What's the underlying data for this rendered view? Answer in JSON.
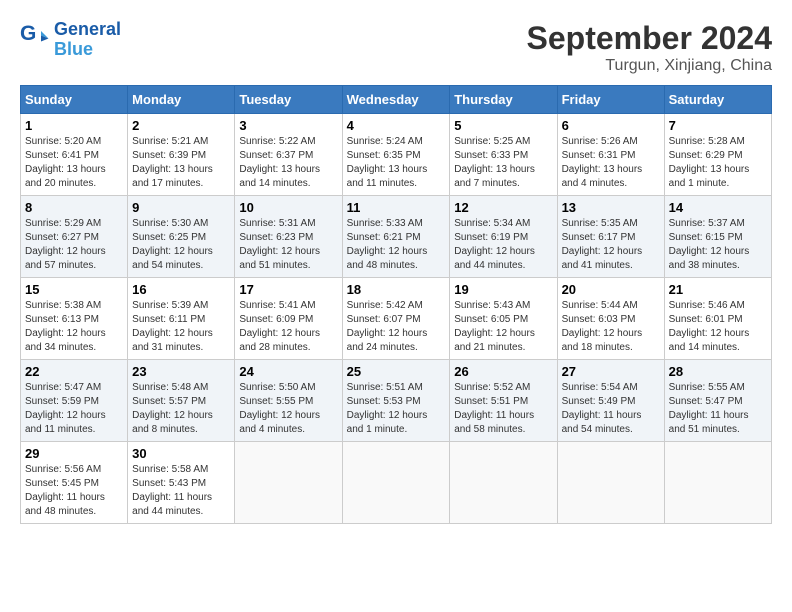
{
  "header": {
    "logo_text_line1": "General",
    "logo_text_line2": "Blue",
    "month_title": "September 2024",
    "location": "Turgun, Xinjiang, China"
  },
  "weekdays": [
    "Sunday",
    "Monday",
    "Tuesday",
    "Wednesday",
    "Thursday",
    "Friday",
    "Saturday"
  ],
  "weeks": [
    [
      {
        "day": "1",
        "info": "Sunrise: 5:20 AM\nSunset: 6:41 PM\nDaylight: 13 hours\nand 20 minutes."
      },
      {
        "day": "2",
        "info": "Sunrise: 5:21 AM\nSunset: 6:39 PM\nDaylight: 13 hours\nand 17 minutes."
      },
      {
        "day": "3",
        "info": "Sunrise: 5:22 AM\nSunset: 6:37 PM\nDaylight: 13 hours\nand 14 minutes."
      },
      {
        "day": "4",
        "info": "Sunrise: 5:24 AM\nSunset: 6:35 PM\nDaylight: 13 hours\nand 11 minutes."
      },
      {
        "day": "5",
        "info": "Sunrise: 5:25 AM\nSunset: 6:33 PM\nDaylight: 13 hours\nand 7 minutes."
      },
      {
        "day": "6",
        "info": "Sunrise: 5:26 AM\nSunset: 6:31 PM\nDaylight: 13 hours\nand 4 minutes."
      },
      {
        "day": "7",
        "info": "Sunrise: 5:28 AM\nSunset: 6:29 PM\nDaylight: 13 hours\nand 1 minute."
      }
    ],
    [
      {
        "day": "8",
        "info": "Sunrise: 5:29 AM\nSunset: 6:27 PM\nDaylight: 12 hours\nand 57 minutes."
      },
      {
        "day": "9",
        "info": "Sunrise: 5:30 AM\nSunset: 6:25 PM\nDaylight: 12 hours\nand 54 minutes."
      },
      {
        "day": "10",
        "info": "Sunrise: 5:31 AM\nSunset: 6:23 PM\nDaylight: 12 hours\nand 51 minutes."
      },
      {
        "day": "11",
        "info": "Sunrise: 5:33 AM\nSunset: 6:21 PM\nDaylight: 12 hours\nand 48 minutes."
      },
      {
        "day": "12",
        "info": "Sunrise: 5:34 AM\nSunset: 6:19 PM\nDaylight: 12 hours\nand 44 minutes."
      },
      {
        "day": "13",
        "info": "Sunrise: 5:35 AM\nSunset: 6:17 PM\nDaylight: 12 hours\nand 41 minutes."
      },
      {
        "day": "14",
        "info": "Sunrise: 5:37 AM\nSunset: 6:15 PM\nDaylight: 12 hours\nand 38 minutes."
      }
    ],
    [
      {
        "day": "15",
        "info": "Sunrise: 5:38 AM\nSunset: 6:13 PM\nDaylight: 12 hours\nand 34 minutes."
      },
      {
        "day": "16",
        "info": "Sunrise: 5:39 AM\nSunset: 6:11 PM\nDaylight: 12 hours\nand 31 minutes."
      },
      {
        "day": "17",
        "info": "Sunrise: 5:41 AM\nSunset: 6:09 PM\nDaylight: 12 hours\nand 28 minutes."
      },
      {
        "day": "18",
        "info": "Sunrise: 5:42 AM\nSunset: 6:07 PM\nDaylight: 12 hours\nand 24 minutes."
      },
      {
        "day": "19",
        "info": "Sunrise: 5:43 AM\nSunset: 6:05 PM\nDaylight: 12 hours\nand 21 minutes."
      },
      {
        "day": "20",
        "info": "Sunrise: 5:44 AM\nSunset: 6:03 PM\nDaylight: 12 hours\nand 18 minutes."
      },
      {
        "day": "21",
        "info": "Sunrise: 5:46 AM\nSunset: 6:01 PM\nDaylight: 12 hours\nand 14 minutes."
      }
    ],
    [
      {
        "day": "22",
        "info": "Sunrise: 5:47 AM\nSunset: 5:59 PM\nDaylight: 12 hours\nand 11 minutes."
      },
      {
        "day": "23",
        "info": "Sunrise: 5:48 AM\nSunset: 5:57 PM\nDaylight: 12 hours\nand 8 minutes."
      },
      {
        "day": "24",
        "info": "Sunrise: 5:50 AM\nSunset: 5:55 PM\nDaylight: 12 hours\nand 4 minutes."
      },
      {
        "day": "25",
        "info": "Sunrise: 5:51 AM\nSunset: 5:53 PM\nDaylight: 12 hours\nand 1 minute."
      },
      {
        "day": "26",
        "info": "Sunrise: 5:52 AM\nSunset: 5:51 PM\nDaylight: 11 hours\nand 58 minutes."
      },
      {
        "day": "27",
        "info": "Sunrise: 5:54 AM\nSunset: 5:49 PM\nDaylight: 11 hours\nand 54 minutes."
      },
      {
        "day": "28",
        "info": "Sunrise: 5:55 AM\nSunset: 5:47 PM\nDaylight: 11 hours\nand 51 minutes."
      }
    ],
    [
      {
        "day": "29",
        "info": "Sunrise: 5:56 AM\nSunset: 5:45 PM\nDaylight: 11 hours\nand 48 minutes."
      },
      {
        "day": "30",
        "info": "Sunrise: 5:58 AM\nSunset: 5:43 PM\nDaylight: 11 hours\nand 44 minutes."
      },
      null,
      null,
      null,
      null,
      null
    ]
  ]
}
